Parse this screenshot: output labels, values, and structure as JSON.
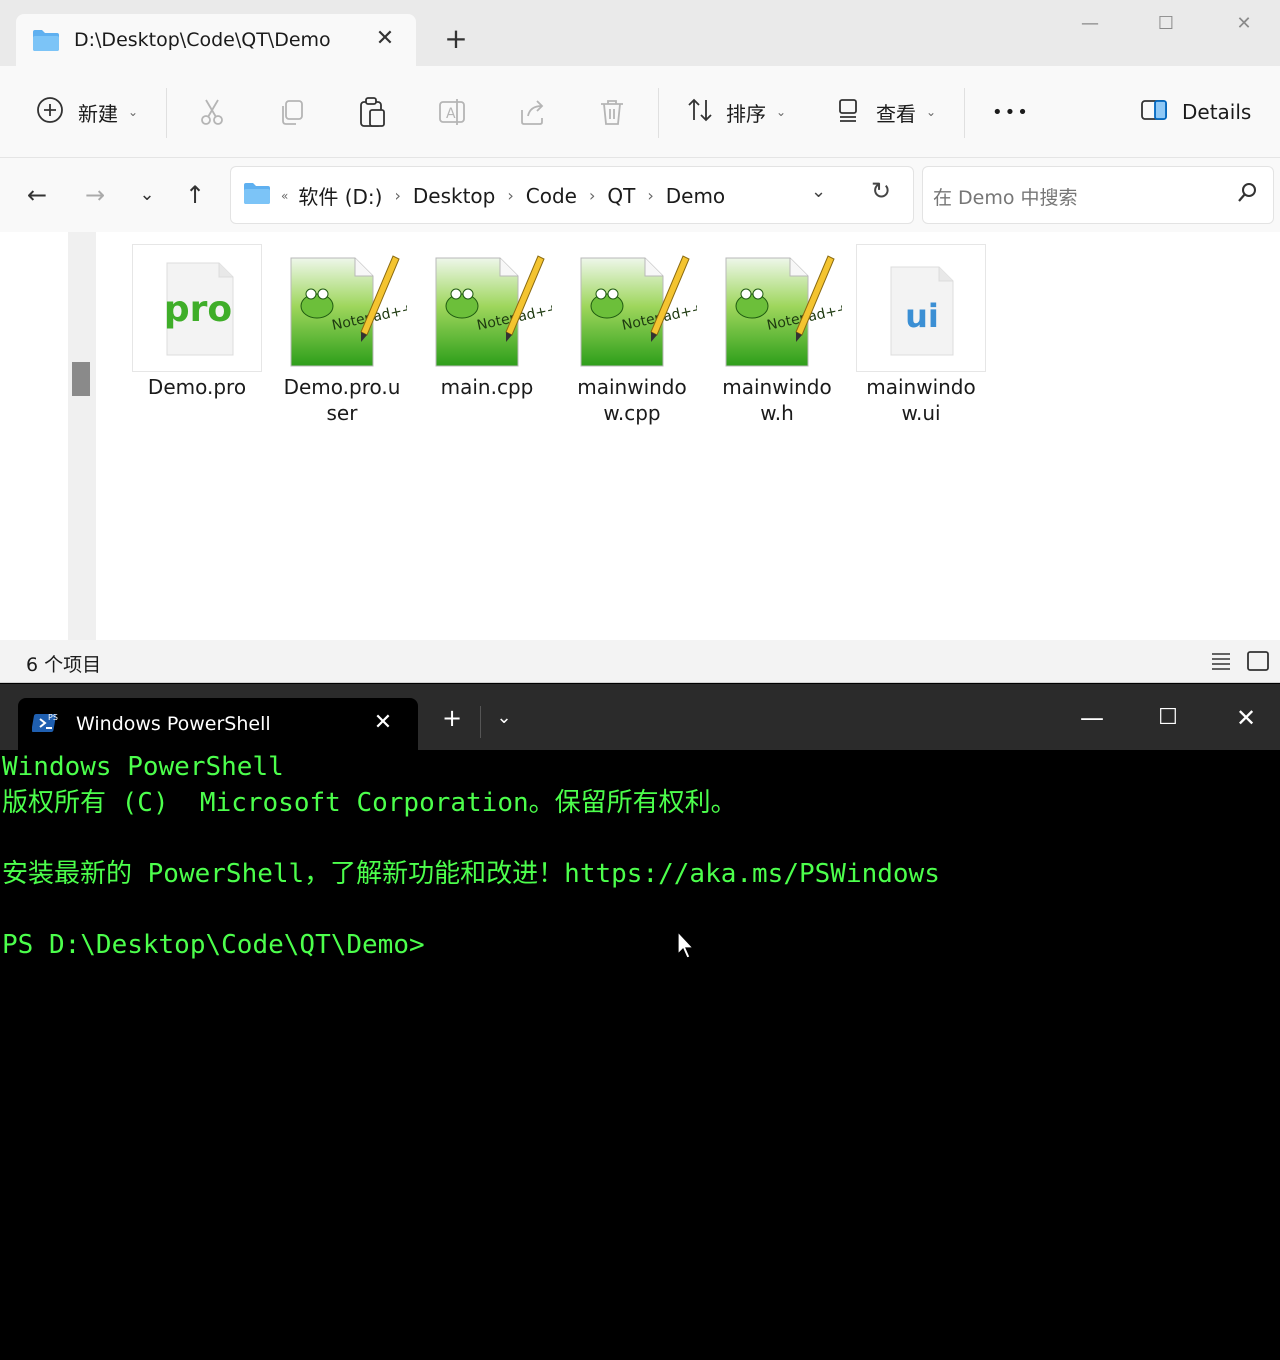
{
  "explorer": {
    "tab_title": "D:\\Desktop\\Code\\QT\\Demo",
    "new_tab": "+",
    "window_controls": {
      "minimize": "—",
      "maximize": "☐",
      "close": "✕"
    },
    "toolbar": {
      "new_label": "新建",
      "sort_label": "排序",
      "view_label": "查看",
      "more": "•••",
      "details_label": "Details"
    },
    "breadcrumbs": [
      "软件 (D:)",
      "Desktop",
      "Code",
      "QT",
      "Demo"
    ],
    "breadcrumb_prefix": "«",
    "search_placeholder": "在 Demo 中搜索",
    "files": [
      {
        "name": "Demo.pro",
        "icon": "pro-file-icon",
        "badge": "pro"
      },
      {
        "name": "Demo.pro.user",
        "icon": "notepadpp-icon",
        "badge": "Notepad++"
      },
      {
        "name": "main.cpp",
        "icon": "notepadpp-icon",
        "badge": "Notepad++"
      },
      {
        "name": "mainwindow.cpp",
        "icon": "notepadpp-icon",
        "badge": "Notepad++"
      },
      {
        "name": "mainwindow.h",
        "icon": "notepadpp-icon",
        "badge": "Notepad++"
      },
      {
        "name": "mainwindow.ui",
        "icon": "ui-file-icon",
        "badge": "ui"
      }
    ],
    "status_count": "6 个项目",
    "colors": {
      "accent": "#0067c0",
      "folder": "#5fb0f0"
    }
  },
  "terminal": {
    "tab_title": "Windows PowerShell",
    "new_tab": "+",
    "lines": [
      "Windows PowerShell",
      "版权所有 (C)  Microsoft Corporation。保留所有权利。",
      "",
      "安装最新的 PowerShell，了解新功能和改进！https://aka.ms/PSWindows",
      "",
      "PS D:\\Desktop\\Code\\QT\\Demo>"
    ],
    "colors": {
      "text": "#4cff4c",
      "background": "#000000"
    }
  }
}
